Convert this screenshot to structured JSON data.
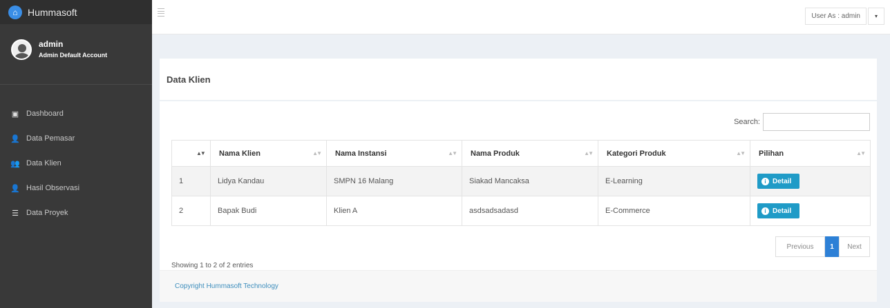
{
  "brand": {
    "name": "Hummasoft",
    "logo_color": "#3a8ee6"
  },
  "user": {
    "name": "admin",
    "role": "Admin Default Account"
  },
  "sidebar": {
    "items": [
      {
        "label": "Dashboard",
        "icon": "dashboard-icon"
      },
      {
        "label": "Data Pemasar",
        "icon": "user-icon"
      },
      {
        "label": "Data Klien",
        "icon": "users-icon"
      },
      {
        "label": "Hasil Observasi",
        "icon": "user-icon"
      },
      {
        "label": "Data Proyek",
        "icon": "list-icon"
      }
    ]
  },
  "topbar": {
    "user_as": "User As : admin",
    "caret": "▾"
  },
  "page": {
    "title": "Data Klien"
  },
  "search": {
    "label": "Search:",
    "value": "",
    "placeholder": ""
  },
  "table": {
    "columns": [
      "",
      "Nama Klien",
      "Nama Instansi",
      "Nama Produk",
      "Kategori Produk",
      "Pilihan"
    ],
    "rows": [
      {
        "no": "1",
        "nama_klien": "Lidya Kandau",
        "nama_instansi": "SMPN 16 Malang",
        "nama_produk": "Siakad Mancaksa",
        "kategori": "E-Learning",
        "action": "Detail"
      },
      {
        "no": "2",
        "nama_klien": "Bapak Budi",
        "nama_instansi": "Klien A",
        "nama_produk": "asdsadsadasd",
        "kategori": "E-Commerce",
        "action": "Detail"
      }
    ]
  },
  "info": "Showing 1 to 2 of 2 entries",
  "pagination": {
    "previous": "Previous",
    "current": "1",
    "next": "Next"
  },
  "footer": {
    "text": "Copyright Hummasoft Technology"
  },
  "colors": {
    "sidebar": "#393939",
    "primary": "#2d80d6",
    "info": "#1f9bc7",
    "link": "#3c8dbc"
  }
}
